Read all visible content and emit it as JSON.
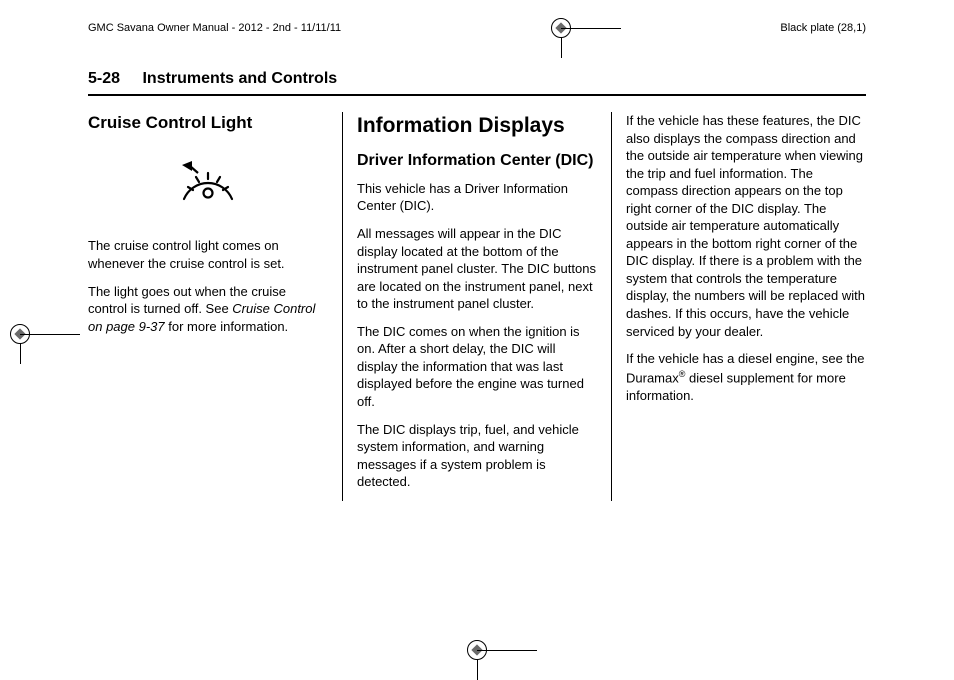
{
  "header": {
    "left": "GMC Savana Owner Manual - 2012 - 2nd - 11/11/11",
    "right": "Black plate (28,1)"
  },
  "page": {
    "number": "5-28",
    "section_title": "Instruments and Controls"
  },
  "col1": {
    "heading": "Cruise Control Light",
    "p1": "The cruise control light comes on whenever the cruise control is set.",
    "p2a": "The light goes out when the cruise control is turned off. See ",
    "p2_ref": "Cruise Control on page 9‑37",
    "p2b": " for more information."
  },
  "col2": {
    "heading_main": "Information Displays",
    "heading_sub": "Driver Information Center (DIC)",
    "p1": "This vehicle has a Driver Information Center (DIC).",
    "p2": "All messages will appear in the DIC display located at the bottom of the instrument panel cluster. The DIC buttons are located on the instrument panel, next to the instrument panel cluster.",
    "p3": "The DIC comes on when the ignition is on. After a short delay, the DIC will display the information that was last displayed before the engine was turned off.",
    "p4": "The DIC displays trip, fuel, and vehicle system information, and warning messages if a system problem is detected."
  },
  "col3": {
    "p1": "If the vehicle has these features, the DIC also displays the compass direction and the outside air temperature when viewing the trip and fuel information. The compass direction appears on the top right corner of the DIC display. The outside air temperature automatically appears in the bottom right corner of the DIC display. If there is a problem with the system that controls the temperature display, the numbers will be replaced with dashes. If this occurs, have the vehicle serviced by your dealer.",
    "p2a": "If the vehicle has a diesel engine, see the Duramax",
    "p2_reg": "®",
    "p2b": " diesel supplement for more information."
  }
}
